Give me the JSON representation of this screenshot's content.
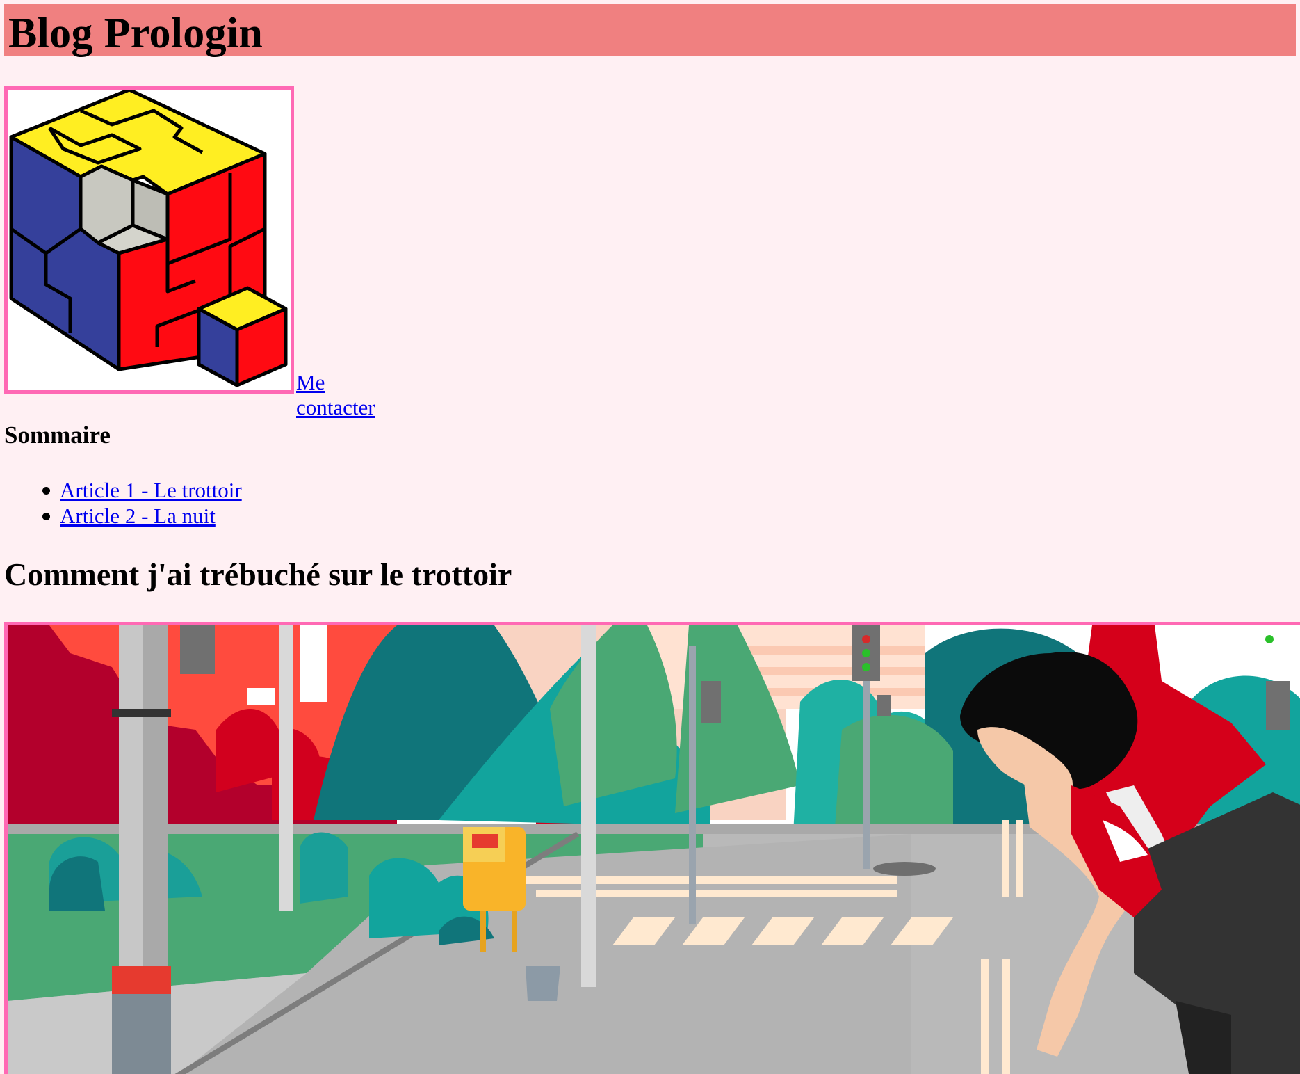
{
  "header": {
    "title": "Blog Prologin"
  },
  "logo": {
    "icon": "cube-puzzle-logo"
  },
  "nav": {
    "contact_label": "Me contacter"
  },
  "toc": {
    "title": "Sommaire",
    "items": [
      {
        "label": "Article 1 - Le trottoir"
      },
      {
        "label": "Article 2 - La nuit"
      }
    ]
  },
  "article": {
    "title": "Comment j'ai trébuché sur le trottoir",
    "image_icon": "street-illustration-woman-tripping"
  },
  "colors": {
    "header_bg": "#f08080",
    "page_bg": "#fff0f3",
    "frame_border": "#ff69b4",
    "link": "#0000ee"
  }
}
